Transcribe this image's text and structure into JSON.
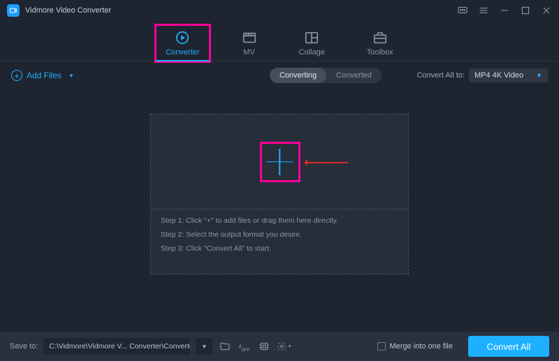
{
  "app": {
    "title": "Vidmore Video Converter"
  },
  "nav": [
    {
      "label": "Converter",
      "icon": "converter"
    },
    {
      "label": "MV",
      "icon": "mv"
    },
    {
      "label": "Collage",
      "icon": "collage"
    },
    {
      "label": "Toolbox",
      "icon": "toolbox"
    }
  ],
  "subbar": {
    "addFiles": "Add Files",
    "seg": {
      "converting": "Converting",
      "converted": "Converted"
    },
    "convertAllTo": "Convert All to:",
    "format": "MP4 4K Video"
  },
  "dropzone": {
    "step1": "Step 1: Click \"+\" to add files or drag them here directly.",
    "step2": "Step 2: Select the output format you desire.",
    "step3": "Step 3: Click \"Convert All\" to start."
  },
  "bottom": {
    "saveTo": "Save to:",
    "path": "C:\\Vidmore\\Vidmore V... Converter\\Converted",
    "merge": "Merge into one file",
    "convertAll": "Convert All"
  }
}
